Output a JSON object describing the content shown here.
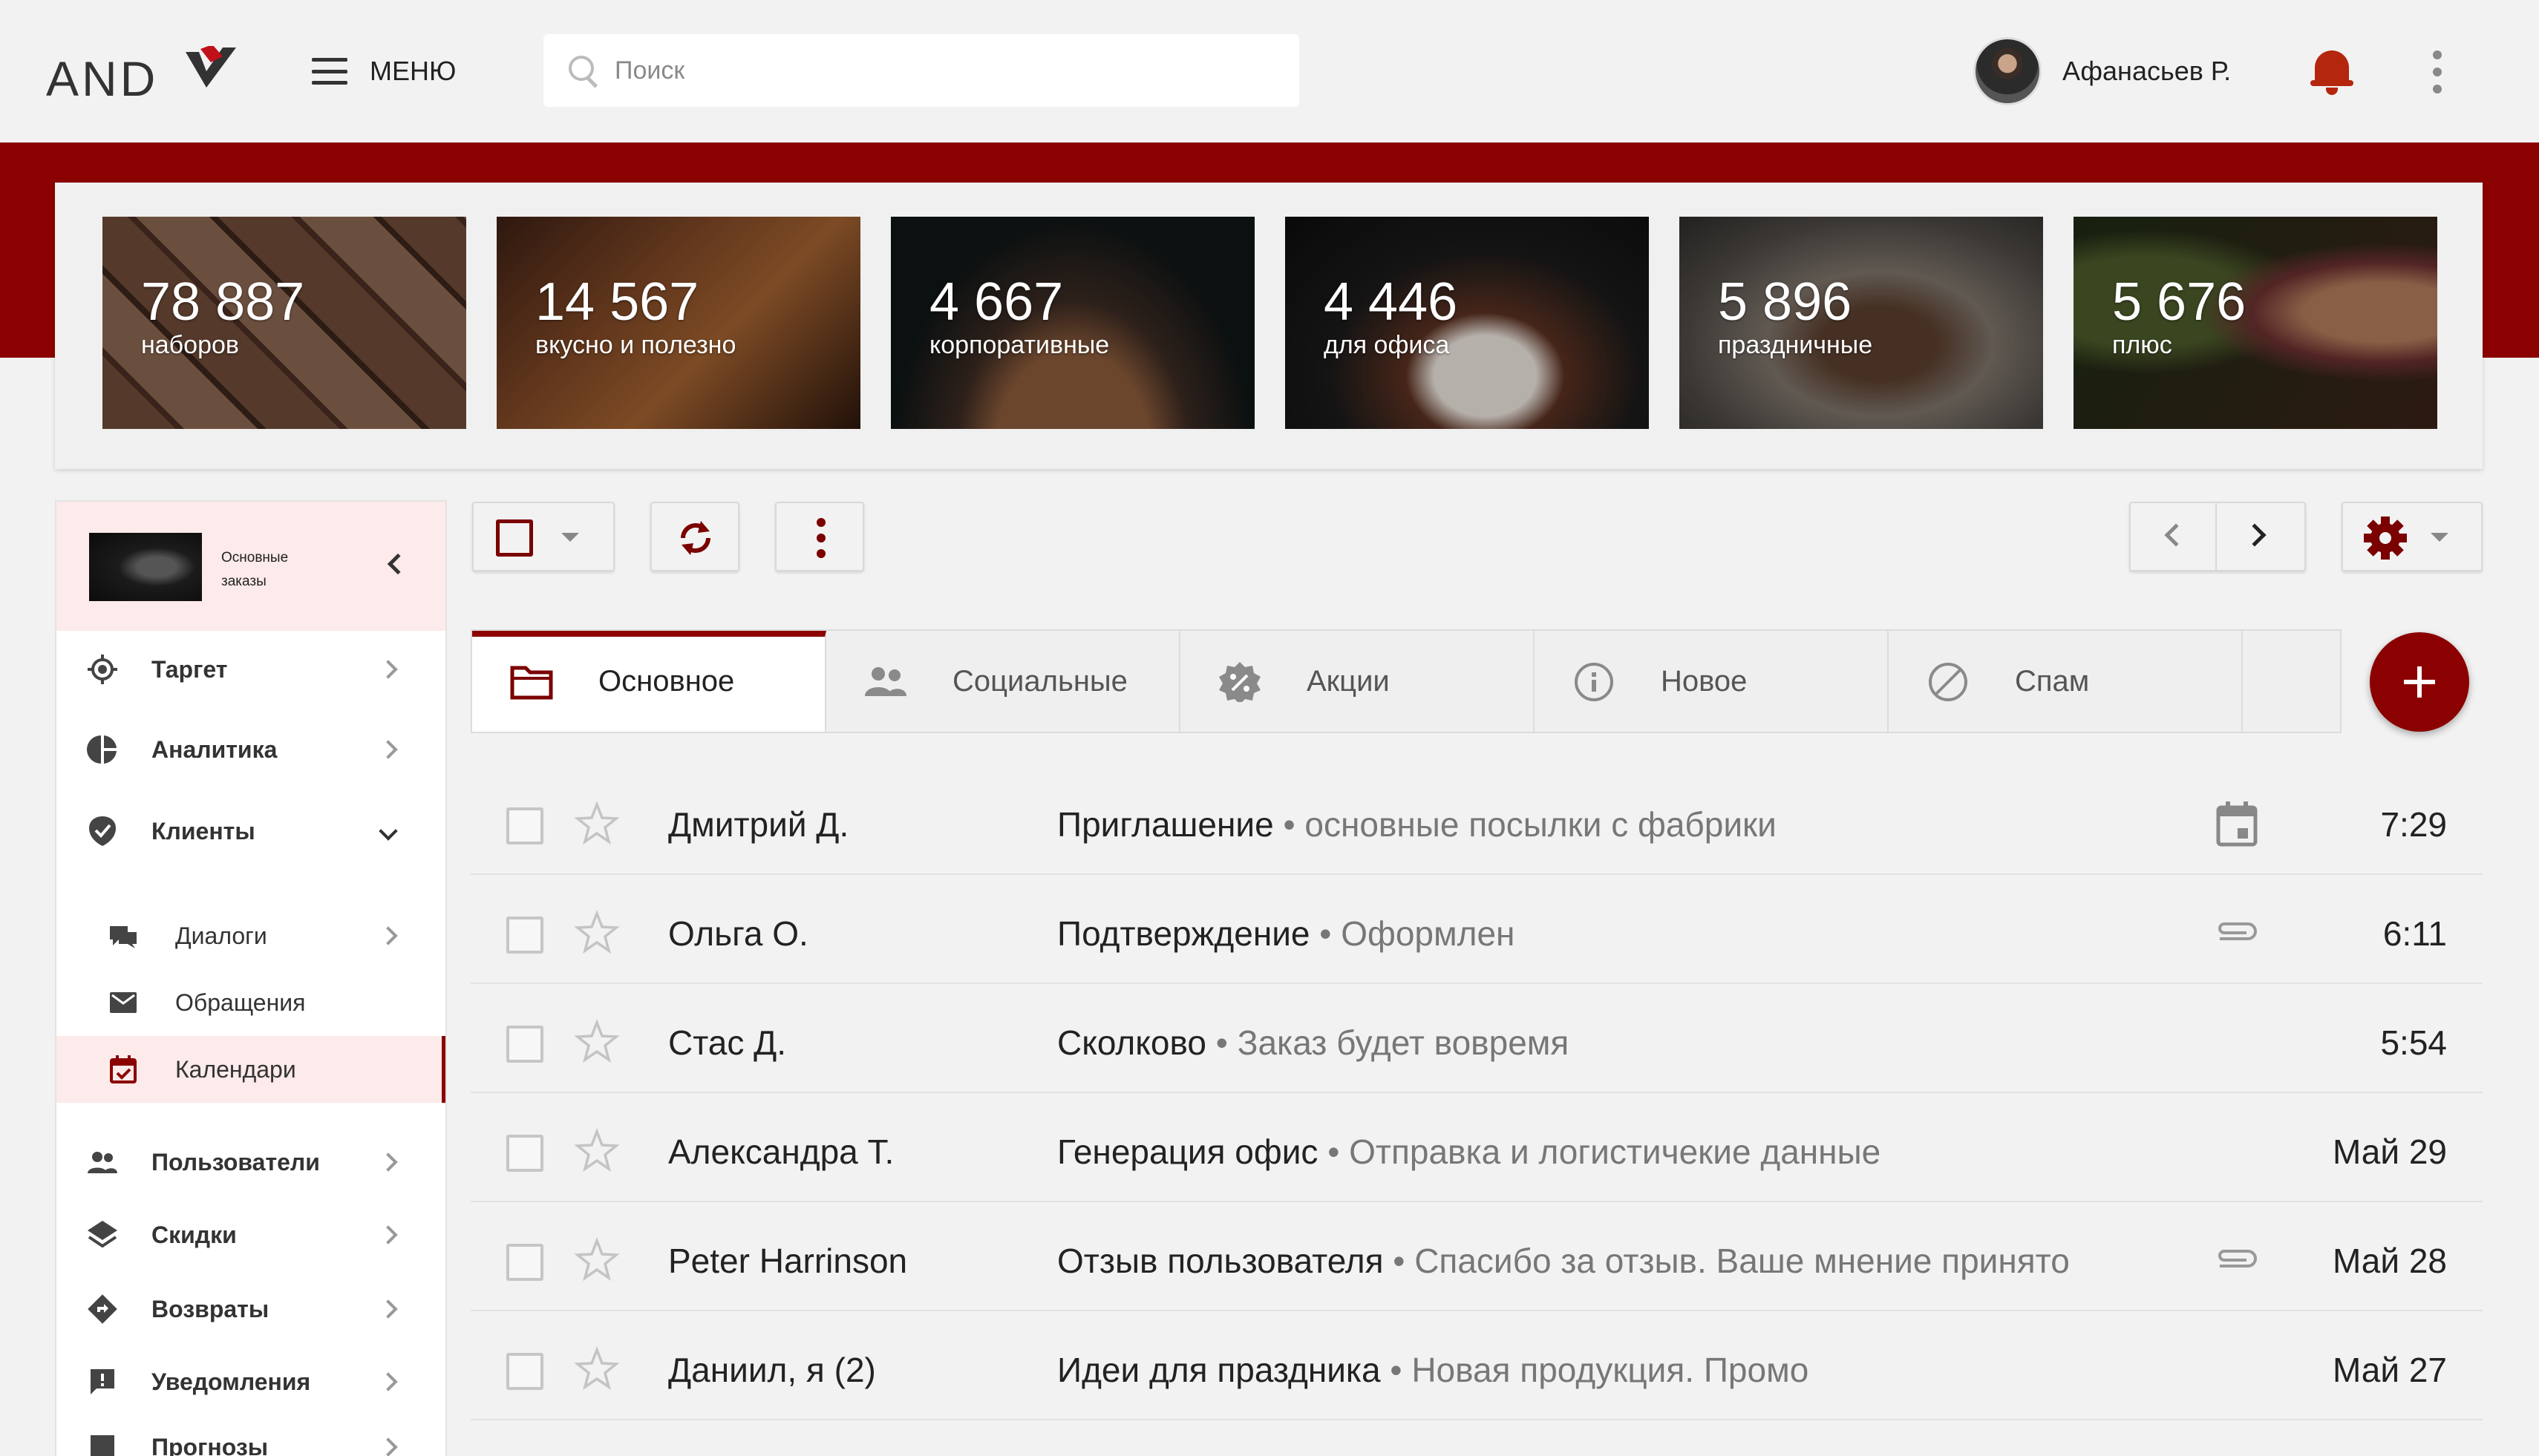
{
  "header": {
    "logo_text": "AND",
    "menu_label": "МЕНЮ",
    "search_placeholder": "Поиск",
    "user_name": "Афанасьев Р."
  },
  "stats": [
    {
      "value": "78 887",
      "label": "наборов"
    },
    {
      "value": "14 567",
      "label": "вкусно и полезно"
    },
    {
      "value": "4 667",
      "label": "корпоративные"
    },
    {
      "value": "4 446",
      "label": "для офиса"
    },
    {
      "value": "5 896",
      "label": "праздничные"
    },
    {
      "value": "5 676",
      "label": "плюс"
    }
  ],
  "sidebar": {
    "title": "Основные заказы",
    "items": [
      {
        "label": "Таргет",
        "icon": "target-icon"
      },
      {
        "label": "Аналитика",
        "icon": "pie-chart-icon"
      },
      {
        "label": "Клиенты",
        "icon": "verified-shield-icon"
      },
      {
        "label": "Пользователи",
        "icon": "people-icon"
      },
      {
        "label": "Скидки",
        "icon": "layers-icon"
      },
      {
        "label": "Возвраты",
        "icon": "directions-icon"
      },
      {
        "label": "Уведомления",
        "icon": "feedback-icon"
      },
      {
        "label": "Прогнозы",
        "icon": "chart-icon"
      }
    ],
    "subitems": [
      {
        "label": "Диалоги",
        "icon": "chat-icon"
      },
      {
        "label": "Обращения",
        "icon": "mail-icon"
      },
      {
        "label": "Календари",
        "icon": "calendar-check-icon"
      }
    ]
  },
  "tabs": [
    {
      "label": "Основное",
      "icon": "folder-icon",
      "active": true
    },
    {
      "label": "Социальные",
      "icon": "people-icon",
      "active": false
    },
    {
      "label": "Акции",
      "icon": "discount-badge-icon",
      "active": false
    },
    {
      "label": "Новое",
      "icon": "info-icon",
      "active": false
    },
    {
      "label": "Спам",
      "icon": "block-icon",
      "active": false
    }
  ],
  "messages": [
    {
      "sender": "Дмитрий Д.",
      "subject": "Приглашение",
      "snippet": "основные посылки с фабрики",
      "meta_icon": "calendar-icon",
      "time": "7:29"
    },
    {
      "sender": "Ольга О.",
      "subject": "Подтверждение",
      "snippet": "Оформлен",
      "meta_icon": "attachment-icon",
      "time": "6:11"
    },
    {
      "sender": "Стас Д.",
      "subject": "Сколково",
      "snippet": "Заказ будет вовремя",
      "meta_icon": "",
      "time": "5:54"
    },
    {
      "sender": "Александра Т.",
      "subject": "Генерация офис",
      "snippet": "Отправка и логистичекие данные",
      "meta_icon": "",
      "time": "Май 29"
    },
    {
      "sender": "Peter Harrinson",
      "subject": "Отзыв пользователя",
      "snippet": "Спасибо за отзыв. Ваше мнение принято",
      "meta_icon": "attachment-icon",
      "time": "Май 28"
    },
    {
      "sender": "Даниил, я (2)",
      "subject": "Идеи для праздника",
      "snippet": "Новая продукция. Промо",
      "meta_icon": "",
      "time": "Май 27"
    }
  ],
  "colors": {
    "brand": "#8b0000",
    "accent_red": "#c0101a",
    "bell": "#b5260f"
  }
}
